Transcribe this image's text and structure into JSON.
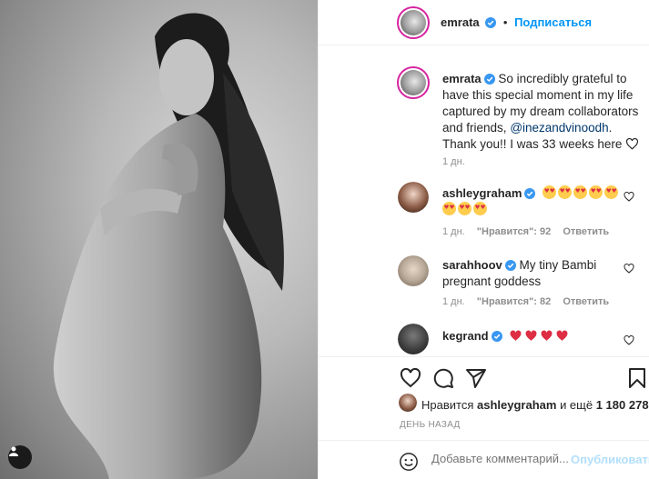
{
  "post": {
    "author": "emrata",
    "follow_label": "Подписаться",
    "dot": "•",
    "caption_author": "emrata",
    "caption_pre": "So incredibly grateful to have this special moment in my life captured by my dream collaborators and friends,",
    "caption_mention": "@inezandvinoodh",
    "caption_post": ". Thank you!! I was 33 weeks here",
    "caption_time": "1 дн."
  },
  "comments": [
    {
      "user": "ashleygraham",
      "emoji_count": 8,
      "time": "1 дн.",
      "likes_label": "\"Нравится\": 92",
      "reply": "Ответить"
    },
    {
      "user": "sarahhoov",
      "text": "My tiny Bambi pregnant goddess",
      "time": "1 дн.",
      "likes_label": "\"Нравится\": 82",
      "reply": "Ответить"
    },
    {
      "user": "kegrand",
      "heart_count": 4
    }
  ],
  "likes": {
    "prefix": "Нравится",
    "user": "ashleygraham",
    "middle": "и ещё",
    "count": "1 180 278"
  },
  "time_ago": "ДЕНЬ НАЗАД",
  "add_comment": {
    "placeholder": "Добавьте комментарий...",
    "publish": "Опубликовать"
  },
  "icons": [
    "like-icon",
    "comment-icon",
    "share-icon",
    "save-icon",
    "emoji-icon",
    "verified-icon",
    "user-tag-icon"
  ],
  "colors": {
    "accent": "#0095f6",
    "verified": "#3897f0",
    "text": "#262626",
    "muted": "#8e8e8e"
  }
}
